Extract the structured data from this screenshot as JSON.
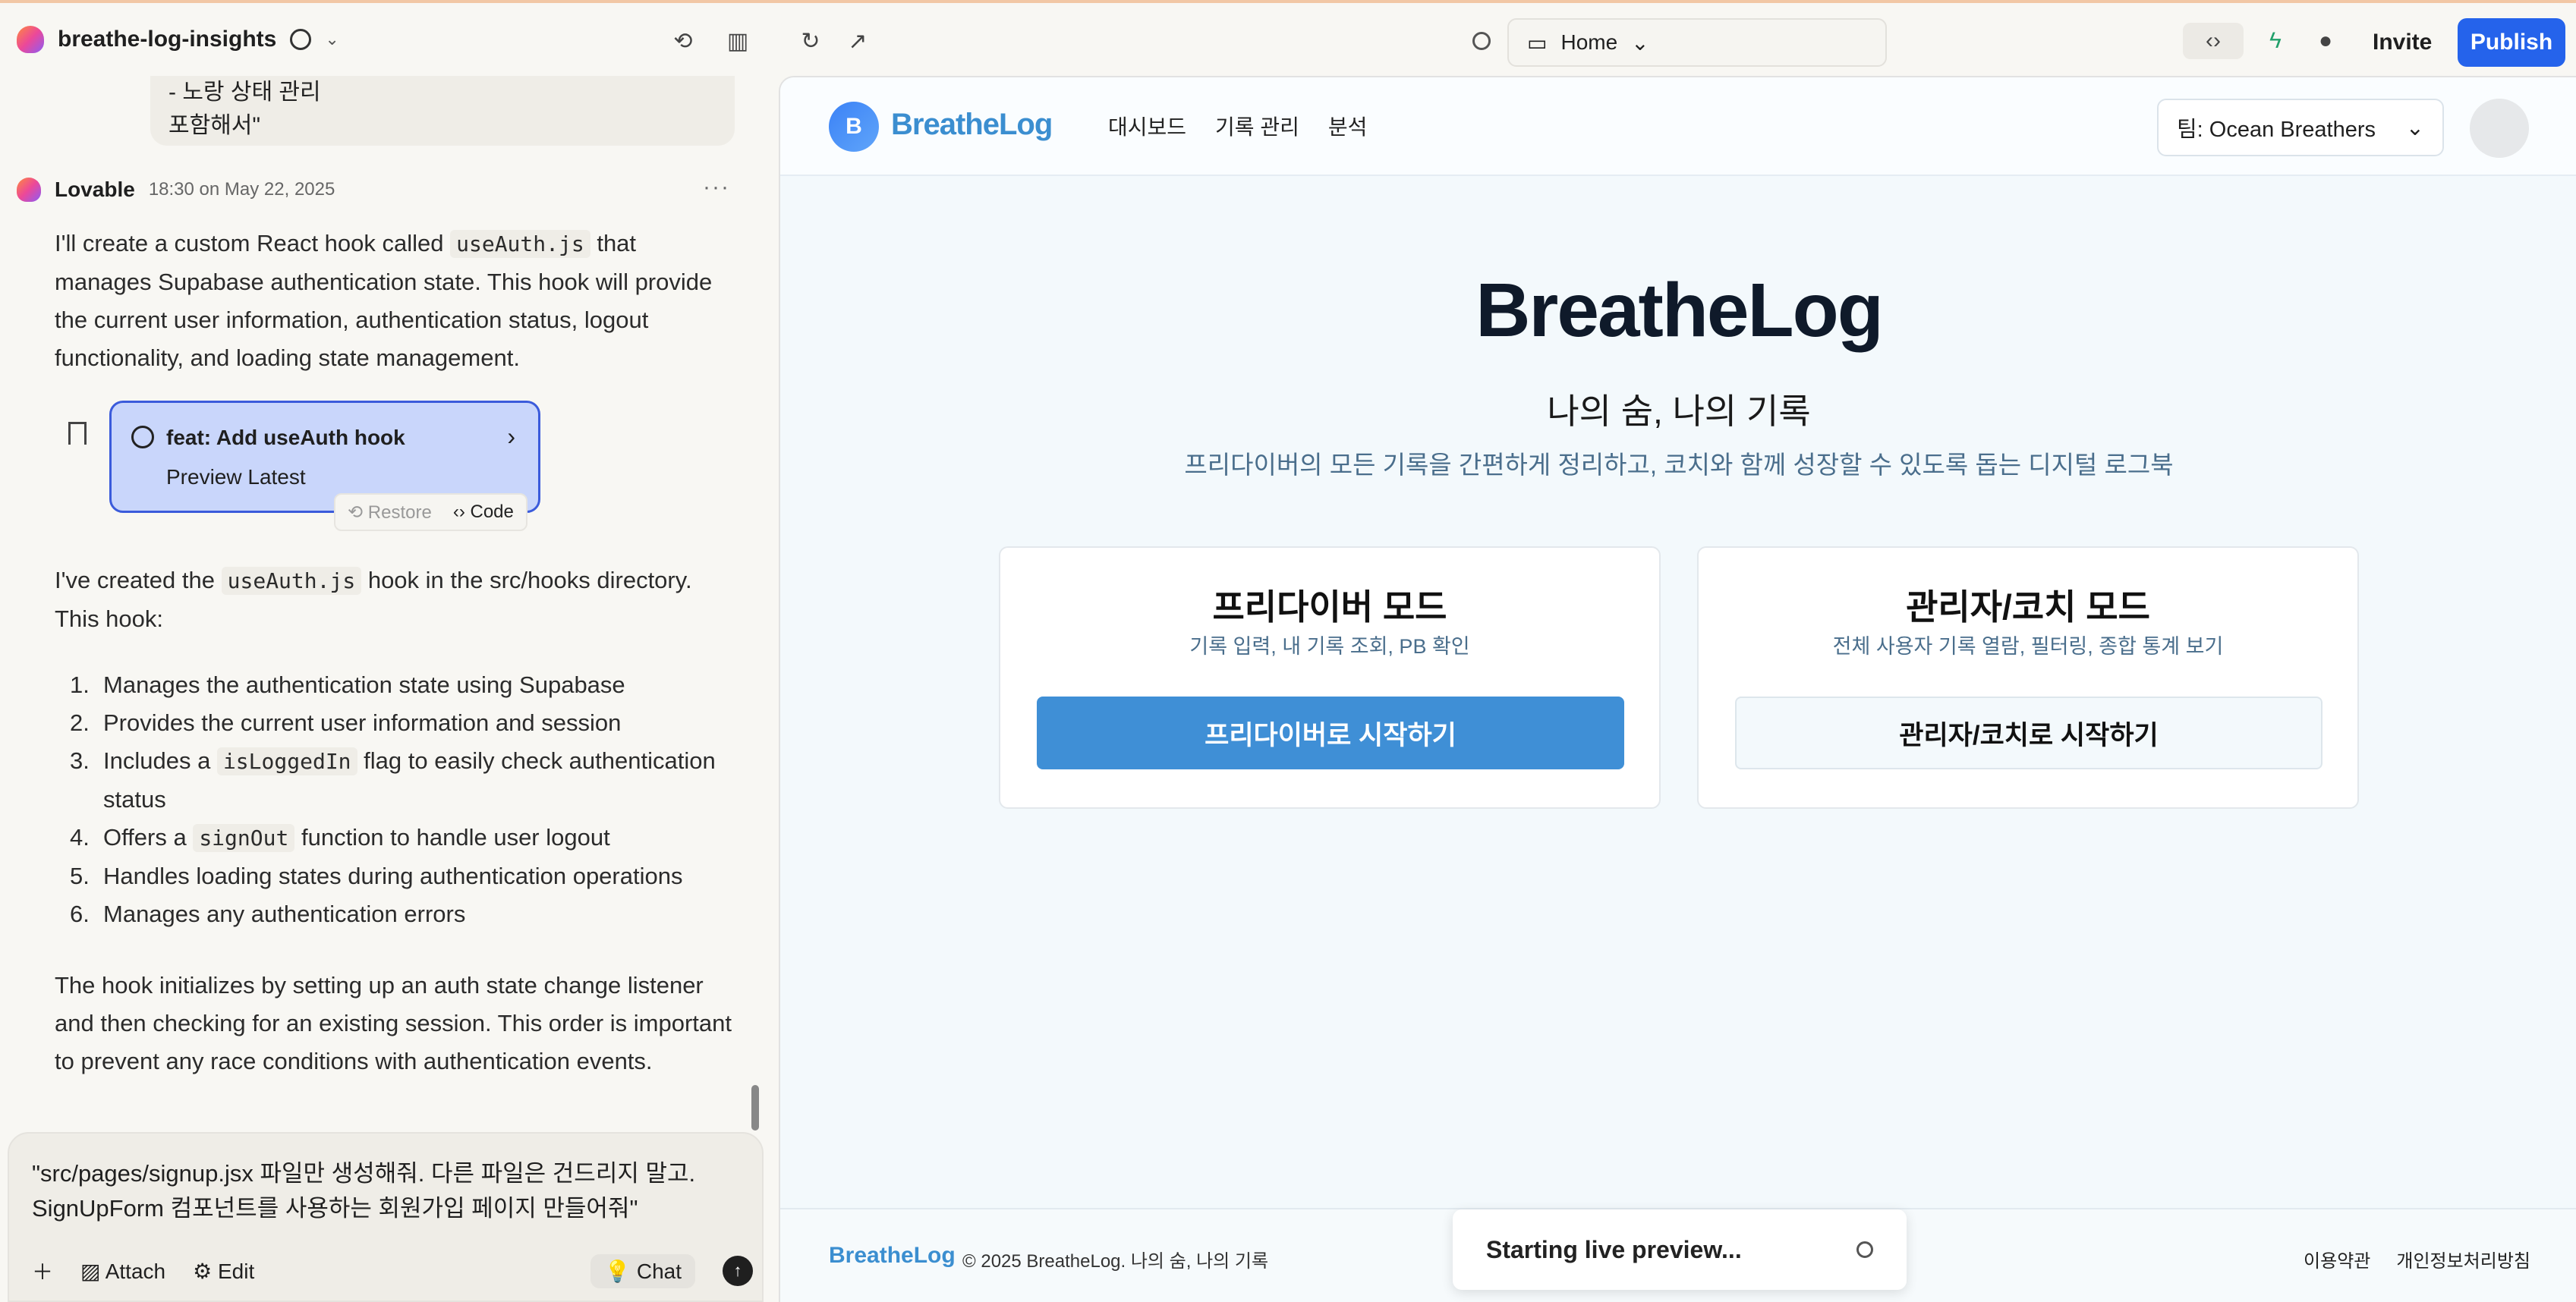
{
  "topbar": {
    "project_name": "breathe-log-insights",
    "url": "Home",
    "invite_label": "Invite",
    "publish_label": "Publish"
  },
  "chat": {
    "previous_bubble": [
      "- 노랑 상태 관리",
      "포함해서\""
    ],
    "message": {
      "author": "Lovable",
      "time": "18:30 on May 22, 2025",
      "intro_pre": "I'll create a custom React hook called",
      "intro_code": "useAuth.js",
      "intro_post": "that manages Supabase authentication state. This hook will provide the current user information, authentication status, logout functionality, and loading state management.",
      "commit_title": "feat: Add useAuth hook",
      "commit_sub": "Preview Latest",
      "restore_label": "Restore",
      "code_label": "Code",
      "created_pre": "I've created the",
      "created_code": "useAuth.js",
      "created_post": "hook in the src/hooks directory. This hook:",
      "list": [
        {
          "num": "1.",
          "text": "Manages the authentication state using Supabase"
        },
        {
          "num": "2.",
          "text": "Provides the current user information and session"
        },
        {
          "num": "3.",
          "pre": "Includes a",
          "code": "isLoggedIn",
          "post": "flag to easily check authentication status"
        },
        {
          "num": "4.",
          "pre": "Offers a",
          "code": "signOut",
          "post": "function to handle user logout"
        },
        {
          "num": "5.",
          "text": "Handles loading states during authentication operations"
        },
        {
          "num": "6.",
          "text": "Manages any authentication errors"
        }
      ],
      "outro": "The hook initializes by setting up an auth state change listener and then checking for an existing session. This order is important to prevent any race conditions with authentication events."
    },
    "composer": {
      "text": "\"src/pages/signup.jsx 파일만 생성해줘. 다른 파일은 건드리지 말고. SignUpForm 컴포넌트를 사용하는 회원가입 페이지 만들어줘\"",
      "attach_label": "Attach",
      "edit_label": "Edit",
      "chat_label": "Chat"
    }
  },
  "site": {
    "brand_initial": "B",
    "brand_name": "BreatheLog",
    "nav": [
      "대시보드",
      "기록 관리",
      "분석"
    ],
    "team_select": "팀: Ocean Breathers",
    "hero_title": "BreatheLog",
    "hero_sub": "나의 숨, 나의 기록",
    "hero_desc": "프리다이버의 모든 기록을 간편하게 정리하고, 코치와 함께 성장할 수 있도록 돕는 디지털 로그북",
    "modes": [
      {
        "title": "프리다이버 모드",
        "desc": "기록 입력, 내 기록 조회, PB 확인",
        "button": "프리다이버로 시작하기"
      },
      {
        "title": "관리자/코치 모드",
        "desc": "전체 사용자 기록 열람, 필터링, 종합 통계 보기",
        "button": "관리자/코치로 시작하기"
      }
    ],
    "footer_brand": "BreatheLog",
    "footer_copy": "© 2025 BreatheLog. 나의 숨, 나의 기록",
    "footer_links": [
      "이용약관",
      "개인정보처리방침"
    ]
  },
  "toast": "Starting live preview...",
  "colors": {
    "publish": "#2563eb",
    "brand": "#3b8ed0",
    "primary_button": "#3f8fd6",
    "commit_card": "#c9d6fb"
  }
}
